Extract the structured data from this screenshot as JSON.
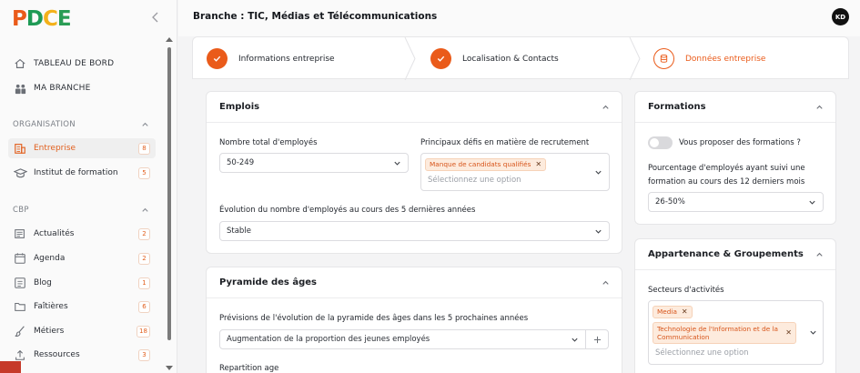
{
  "brand": {
    "logo_letters": [
      "P",
      "D",
      "C",
      "E"
    ],
    "colors": {
      "accent": "#ea5b1a",
      "p": "#ea5b1a",
      "d": "#1e9a55",
      "c": "#f3b11a",
      "e": "#2a9d55"
    }
  },
  "sidebar": {
    "main_items": [
      {
        "label": "TABLEAU DE BORD",
        "icon": "home-icon"
      },
      {
        "label": "MA BRANCHE",
        "icon": "people-icon"
      }
    ],
    "sections": [
      {
        "title": "ORGANISATION",
        "items": [
          {
            "label": "Entreprise",
            "badge": "8",
            "icon": "building-icon",
            "active": true
          },
          {
            "label": "Institut de formation",
            "badge": "5",
            "icon": "graduation-icon"
          }
        ]
      },
      {
        "title": "CBP",
        "items": [
          {
            "label": "Actualités",
            "badge": "2",
            "icon": "newspaper-icon"
          },
          {
            "label": "Agenda",
            "badge": "2",
            "icon": "calendar-icon"
          },
          {
            "label": "Blog",
            "badge": "1",
            "icon": "blog-icon"
          },
          {
            "label": "Faîtières",
            "badge": "6",
            "icon": "folder-icon"
          },
          {
            "label": "Métiers",
            "badge": "18",
            "icon": "brush-icon"
          },
          {
            "label": "Ressources",
            "badge": "3",
            "icon": "upload-icon"
          }
        ]
      }
    ]
  },
  "header": {
    "title": "Branche : TIC, Médias et Télécommunications",
    "avatar_initials": "KD"
  },
  "stepper": {
    "steps": [
      {
        "label": "Informations entreprise",
        "state": "done"
      },
      {
        "label": "Localisation & Contacts",
        "state": "done"
      },
      {
        "label": "Données entreprise",
        "state": "current"
      }
    ]
  },
  "emplois": {
    "title": "Emplois",
    "total_label": "Nombre total d'employés",
    "total_value": "50-249",
    "defis_label": "Principaux défis en matière de recrutement",
    "defis_tags": [
      "Manque de candidats qualifiés"
    ],
    "defis_placeholder": "Sélectionnez une option",
    "evolution_label": "Évolution du nombre d'employés au cours des 5 dernières années",
    "evolution_value": "Stable"
  },
  "pyramide": {
    "title": "Pyramide des âges",
    "prevision_label": "Prévisions de l'évolution de la pyramide des âges dans les 5 prochaines années",
    "prevision_value": "Augmentation de la proportion des jeunes employés",
    "repartition_label": "Repartition age"
  },
  "formations": {
    "title": "Formations",
    "toggle_label": "Vous proposer des formations ?",
    "toggle_on": false,
    "pourcentage_label_1": "Pourcentage d'employés ayant suivi une",
    "pourcentage_label_2": "formation au cours des 12 derniers mois",
    "pourcentage_value": "26-50%"
  },
  "appartenance": {
    "title": "Appartenance & Groupements",
    "secteurs_label": "Secteurs d'activités",
    "secteurs_tags": [
      "Media",
      "Technologie de l'Information et de la",
      "Communication"
    ],
    "secteurs_placeholder": "Sélectionnez une option"
  }
}
